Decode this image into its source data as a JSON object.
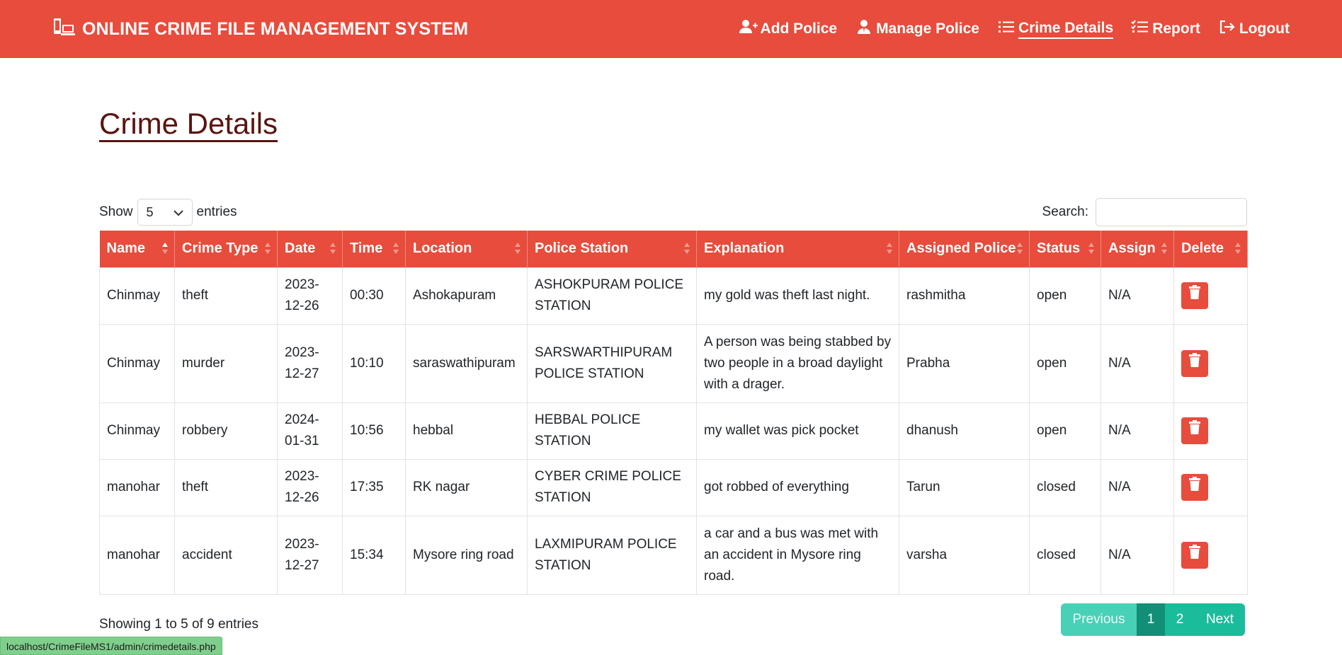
{
  "app": {
    "title": "ONLINE CRIME FILE MANAGEMENT SYSTEM",
    "brand_icon": "police-laptop-icon",
    "accent_color": "#e74c3c",
    "pager_color": "#1abc9c"
  },
  "nav": {
    "items": [
      {
        "label": "Add Police",
        "icon": "user-plus-icon"
      },
      {
        "label": "Manage Police",
        "icon": "user-tie-icon"
      },
      {
        "label": "Crime Details",
        "icon": "list-icon",
        "active": true
      },
      {
        "label": "Report",
        "icon": "list-check-icon"
      },
      {
        "label": "Logout",
        "icon": "logout-icon"
      }
    ]
  },
  "page": {
    "title": "Crime Details"
  },
  "controls": {
    "show_label": "Show",
    "page_length": "5",
    "entries_label": "entries",
    "search_label": "Search:",
    "search_value": ""
  },
  "table": {
    "columns": [
      "Name",
      "Crime Type",
      "Date",
      "Time",
      "Location",
      "Police Station",
      "Explanation",
      "Assigned Police",
      "Status",
      "Assign",
      "Delete"
    ],
    "rows": [
      {
        "name": "Chinmay",
        "crime_type": "theft",
        "date": "2023-12-26",
        "time": "00:30",
        "location": "Ashokapuram",
        "station": "ASHOKPURAM POLICE STATION",
        "explanation": "my gold was theft last night.",
        "assigned": "rashmitha",
        "status": "open",
        "assign": "N/A"
      },
      {
        "name": "Chinmay",
        "crime_type": "murder",
        "date": "2023-12-27",
        "time": "10:10",
        "location": "saraswathipuram",
        "station": "SARSWARTHIPURAM POLICE STATION",
        "explanation": "A person was being stabbed by two people in a broad daylight with a drager.",
        "assigned": "Prabha",
        "status": "open",
        "assign": "N/A"
      },
      {
        "name": "Chinmay",
        "crime_type": "robbery",
        "date": "2024-01-31",
        "time": "10:56",
        "location": "hebbal",
        "station": "HEBBAL POLICE STATION",
        "explanation": "my wallet was pick pocket",
        "assigned": "dhanush",
        "status": "open",
        "assign": "N/A"
      },
      {
        "name": "manohar",
        "crime_type": "theft",
        "date": "2023-12-26",
        "time": "17:35",
        "location": "RK nagar",
        "station": "CYBER CRIME POLICE STATION",
        "explanation": "got robbed of everything",
        "assigned": "Tarun",
        "status": "closed",
        "assign": "N/A"
      },
      {
        "name": "manohar",
        "crime_type": "accident",
        "date": "2023-12-27",
        "time": "15:34",
        "location": "Mysore ring road",
        "station": "LAXMIPURAM POLICE STATION",
        "explanation": "a car and a bus was met with an accident in Mysore ring road.",
        "assigned": "varsha",
        "status": "closed",
        "assign": "N/A"
      }
    ]
  },
  "footer": {
    "info": "Showing 1 to 5 of 9 entries",
    "pagination": [
      "Previous",
      "1",
      "2",
      "Next"
    ]
  },
  "status_bar": {
    "url": "localhost/CrimeFileMS1/admin/crimedetails.php"
  }
}
